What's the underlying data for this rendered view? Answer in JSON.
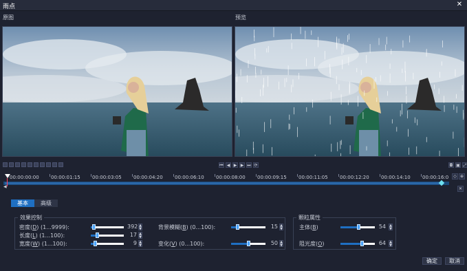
{
  "window": {
    "title": "雨点",
    "close_icon": "close-icon"
  },
  "panes": {
    "original_label": "原图",
    "preview_label": "预览"
  },
  "timeline": {
    "labels": [
      "00:00:00:00",
      "00:00:01:15",
      "00:00:03:05",
      "00:00:04:20",
      "00:00:06:10",
      "00:00:08:00",
      "00:00:09:15",
      "00:00:11:05",
      "00:00:12:20",
      "00:00:14:10",
      "00:00:16:0"
    ]
  },
  "tabs": {
    "basic": "基本",
    "advanced": "高级"
  },
  "effect_control": {
    "title": "效果控制",
    "density": {
      "label_pre": "密度(",
      "key": "D",
      "label_post": ") (1...9999):",
      "value": "392",
      "level": 0.04
    },
    "length": {
      "label_pre": "长度(",
      "key": "L",
      "label_post": ") (1...100):",
      "value": "17",
      "level": 0.17
    },
    "width": {
      "label_pre": "宽度(",
      "key": "W",
      "label_post": ") (1...100):",
      "value": "9",
      "level": 0.09
    },
    "blur": {
      "label_pre": "背景模糊(",
      "key": "B",
      "label_post": ") (0...100):",
      "value": "15",
      "level": 0.15
    },
    "variation": {
      "label_pre": "变化(",
      "key": "V",
      "label_post": ") (0...100):",
      "value": "50",
      "level": 0.5
    }
  },
  "particle": {
    "title": "颗粒属性",
    "body": {
      "label_pre": "主体(",
      "key": "B",
      "label_post": ")",
      "value": "54",
      "level": 0.54
    },
    "opacity": {
      "label_pre": "阻光度(",
      "key": "O",
      "label_post": ")",
      "value": "64",
      "level": 0.64
    }
  },
  "buttons": {
    "ok": "确定",
    "cancel": "取消"
  },
  "colors": {
    "accent": "#1f6fc2",
    "background": "#1e2230",
    "track": "#1a4a7a"
  }
}
